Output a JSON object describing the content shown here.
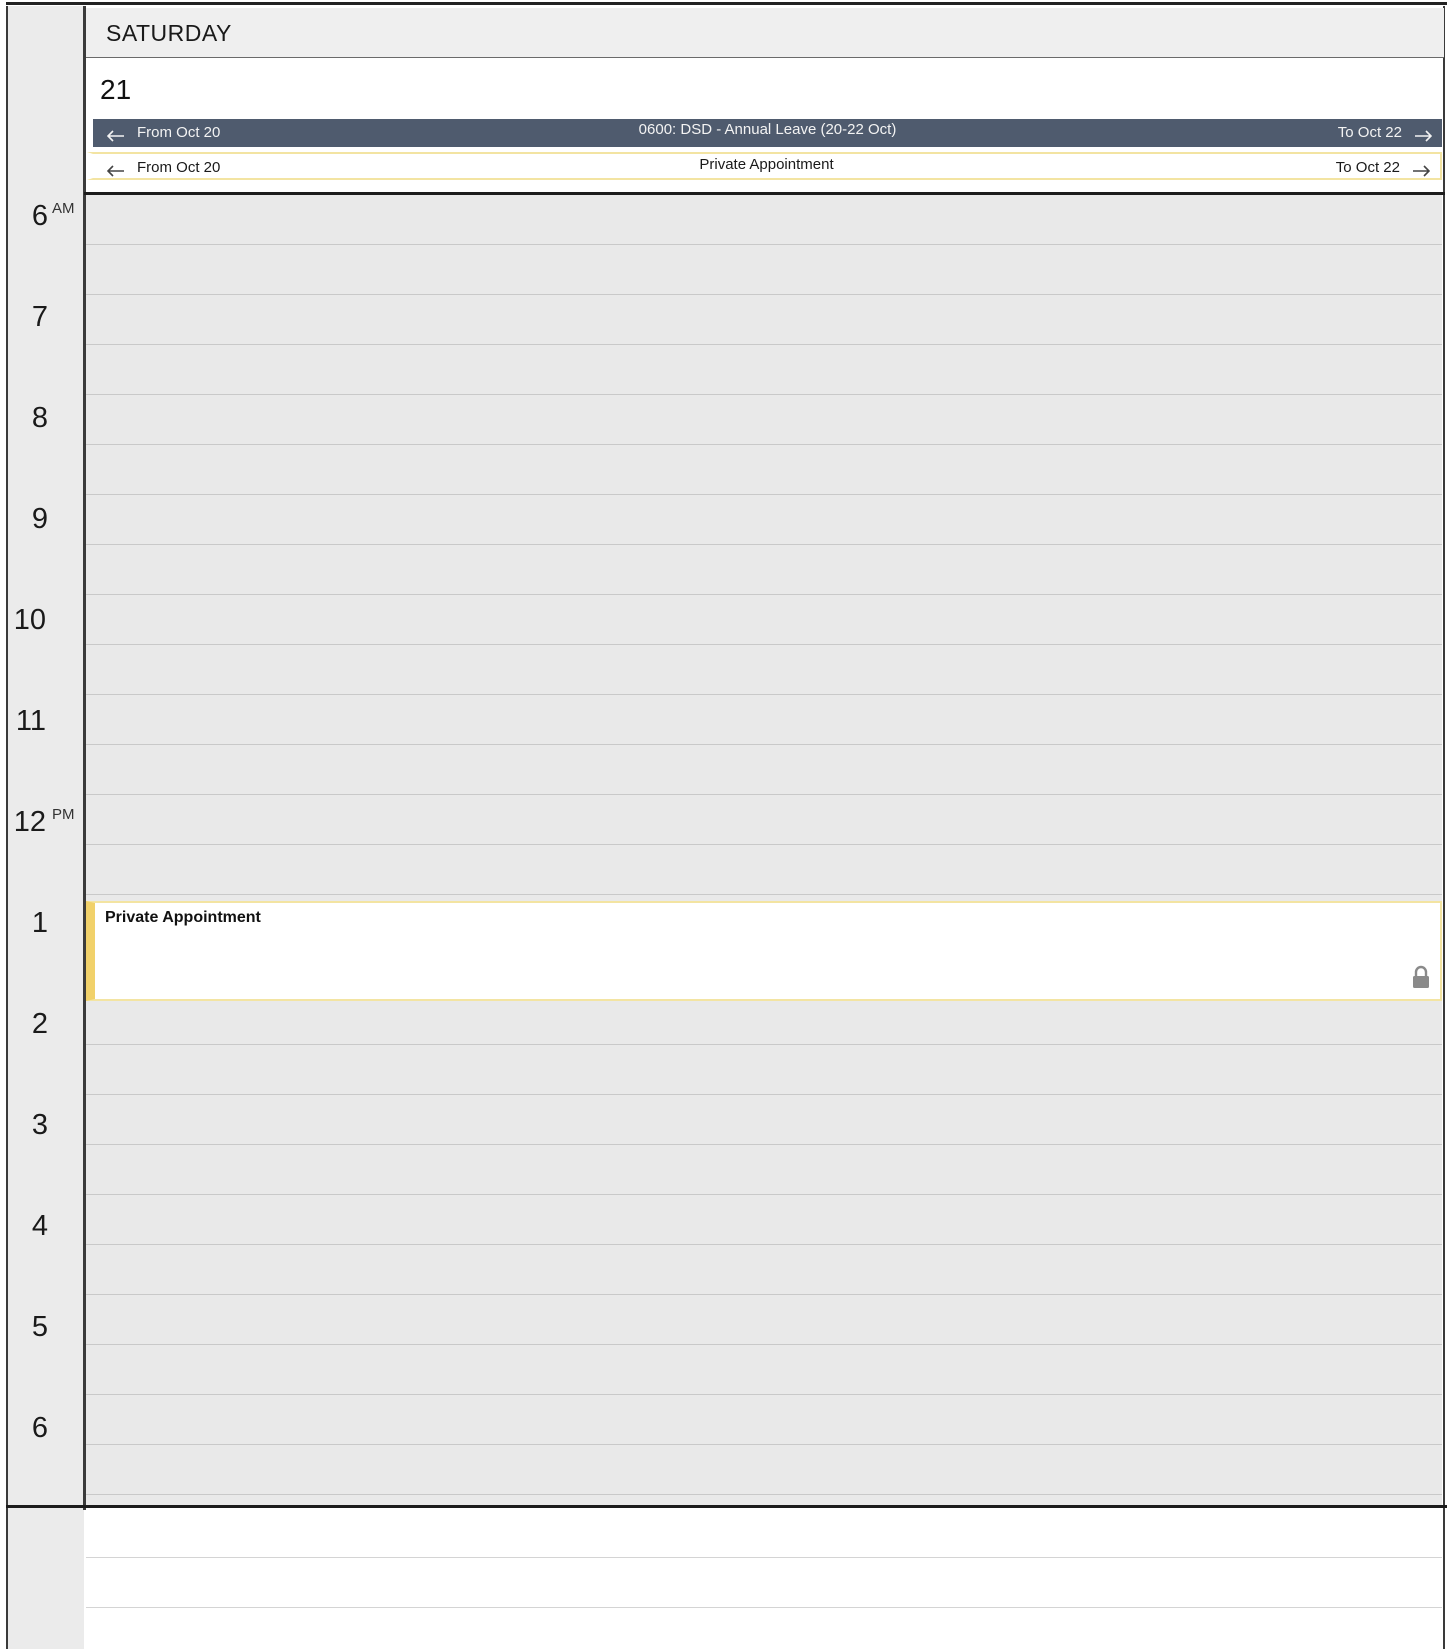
{
  "day_header": {
    "day_name": "SATURDAY",
    "day_number": "21"
  },
  "all_day_events": [
    {
      "from": "From Oct 20",
      "subject": "0600: DSD - Annual Leave (20-22 Oct)",
      "to": "To Oct 22"
    },
    {
      "from": "From Oct 20",
      "subject": "Private Appointment",
      "to": "To Oct 22"
    }
  ],
  "hours": [
    {
      "label": "6",
      "suffix": "AM"
    },
    {
      "label": "7",
      "suffix": ""
    },
    {
      "label": "8",
      "suffix": ""
    },
    {
      "label": "9",
      "suffix": ""
    },
    {
      "label": "10",
      "suffix": ""
    },
    {
      "label": "11",
      "suffix": ""
    },
    {
      "label": "12",
      "suffix": "PM"
    },
    {
      "label": "1",
      "suffix": ""
    },
    {
      "label": "2",
      "suffix": ""
    },
    {
      "label": "3",
      "suffix": ""
    },
    {
      "label": "4",
      "suffix": ""
    },
    {
      "label": "5",
      "suffix": ""
    },
    {
      "label": "6",
      "suffix": ""
    }
  ],
  "timed_events": [
    {
      "title": "Private Appointment",
      "private": true,
      "icon": "lock-icon"
    }
  ],
  "colors": {
    "leave_bar": "#4f5b6e",
    "private_accent": "#f1d16a",
    "grid_background": "#e9e9e9"
  }
}
